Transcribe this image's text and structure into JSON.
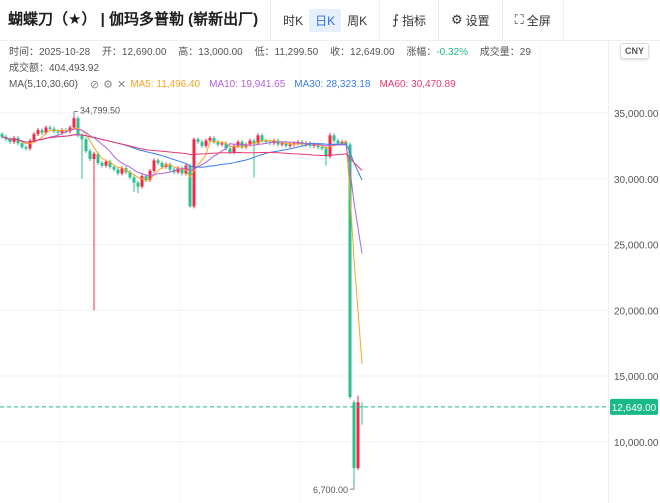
{
  "header": {
    "title": "蝴蝶刀（★） | 伽玛多普勒 (崭新出厂)",
    "periods": [
      {
        "label": "时K",
        "active": false
      },
      {
        "label": "日K",
        "active": true
      },
      {
        "label": "周K",
        "active": false
      }
    ],
    "indicator_label": "指标",
    "settings_label": "设置",
    "fullscreen_label": "全屏"
  },
  "info": {
    "time": "时间：2025-10-28",
    "open": "开：12,690.00",
    "high": "高：13,000.00",
    "low": "低：11,299.50",
    "close": "收：12,649.00",
    "change_label": "涨幅：",
    "change_value": "-0.32%",
    "volume": "成交量：29",
    "turnover": "成交额：404,493.92",
    "ma_label": "MA(5,10,30,60)",
    "ma5": "MA5: 11,496.40",
    "ma10": "MA10: 19,941.65",
    "ma30": "MA30: 28,323.18",
    "ma60": "MA60: 30,470.89"
  },
  "currency": "CNY",
  "colors": {
    "up": "#f0294a",
    "down": "#2dbf8d",
    "ma5": "#f5a623",
    "ma10": "#b562d8",
    "ma30": "#3b7ded",
    "ma60": "#ea3a70",
    "last": "#19b98a"
  },
  "chart_data": {
    "type": "candlestick",
    "y_ticks": [
      35000,
      30000,
      25000,
      20000,
      15000,
      10000
    ],
    "y_tick_labels": [
      "35,000.00",
      "30,000.00",
      "25,000.00",
      "20,000.00",
      "15,000.00",
      "10,000.00"
    ],
    "last_price": 12649,
    "last_price_label": "12,649.00",
    "max_label": "34,799.50",
    "min_label": "6,700.00",
    "max_index": 18,
    "min_index": 88,
    "closes": [
      33200,
      33000,
      32800,
      33100,
      32700,
      32400,
      32300,
      32900,
      33400,
      33700,
      33500,
      33900,
      33800,
      33600,
      33500,
      33700,
      33600,
      33900,
      34600,
      33300,
      33000,
      32100,
      31500,
      31900,
      31200,
      31000,
      31300,
      30900,
      30700,
      30400,
      30800,
      30500,
      30100,
      29700,
      29400,
      30200,
      29900,
      30600,
      31400,
      31200,
      30900,
      31100,
      30700,
      30500,
      30800,
      30400,
      31000,
      27900,
      33000,
      32800,
      32500,
      32900,
      33100,
      32800,
      32600,
      32700,
      32300,
      32000,
      32500,
      32800,
      32400,
      32600,
      32900,
      32700,
      33300,
      32900,
      32800,
      32700,
      32900,
      32600,
      32700,
      32500,
      32600,
      32700,
      32800,
      32600,
      32700,
      32500,
      32600,
      32400,
      32300,
      31700,
      33300,
      32900,
      32700,
      32800,
      32600,
      13400,
      8000,
      13000,
      12649
    ],
    "overrides": {
      "18": {
        "h": 34799.5
      },
      "20": {
        "l": 30000
      },
      "23": {
        "l": 20000
      },
      "33": {
        "l": 29000
      },
      "34": {
        "l": 28900
      },
      "47": {
        "l": 27800
      },
      "63": {
        "l": 30100
      },
      "81": {
        "l": 31000
      },
      "82": {
        "h": 33500
      },
      "88": {
        "o": 13000,
        "l": 6700
      },
      "89": {
        "h": 13500
      },
      "90": {
        "o": 12690,
        "h": 13000,
        "l": 11299.5
      }
    },
    "ma_periods": [
      5,
      10,
      30,
      60
    ]
  }
}
